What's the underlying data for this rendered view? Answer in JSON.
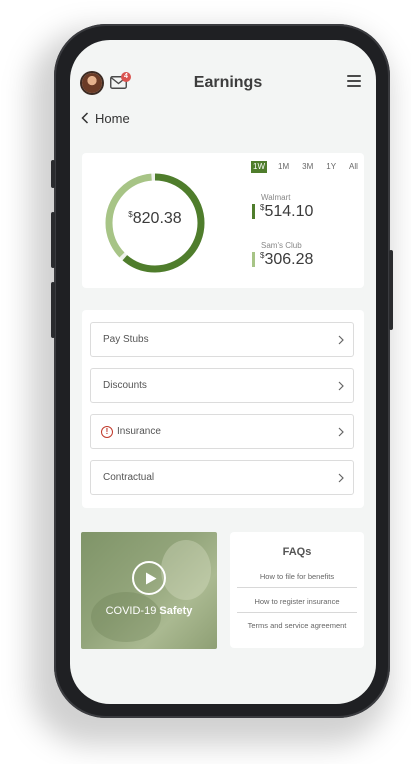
{
  "header": {
    "title": "Earnings",
    "mail_badge": "4"
  },
  "nav": {
    "back_label": "Home"
  },
  "earnings": {
    "total": "820.38",
    "currency": "$",
    "ranges": [
      "1W",
      "1M",
      "3M",
      "1Y",
      "All"
    ],
    "active_range": "1W",
    "stores": [
      {
        "name": "Walmart",
        "amount": "514.10",
        "color": "#4f7d2c"
      },
      {
        "name": "Sam's Club",
        "amount": "306.28",
        "color": "#a7c486"
      }
    ]
  },
  "menu_items": [
    {
      "label": "Pay Stubs",
      "alert": false
    },
    {
      "label": "Discounts",
      "alert": false
    },
    {
      "label": "Insurance",
      "alert": true
    },
    {
      "label": "Contractual",
      "alert": false
    }
  ],
  "video": {
    "caption_prefix": "COVID-19",
    "caption_bold": "Safety"
  },
  "faq": {
    "title": "FAQs",
    "links": [
      "How to file for benefits",
      "How to register insurance",
      "Terms and service agreement"
    ]
  },
  "colors": {
    "accent": "#4f7d2c",
    "accent_light": "#a7c486",
    "alert": "#c0392b"
  }
}
